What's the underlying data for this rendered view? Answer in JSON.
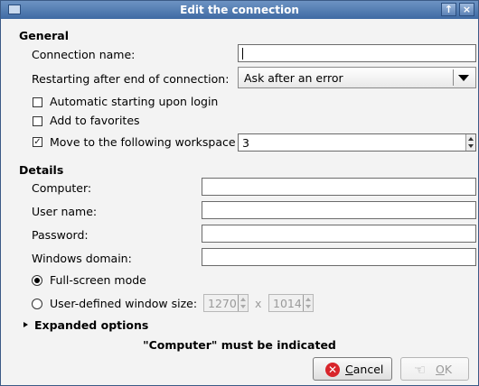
{
  "window": {
    "title": "Edit the connection",
    "controls": {
      "maximize": "↑",
      "close": "×"
    }
  },
  "general": {
    "heading": "General",
    "connection_name_label": "Connection name:",
    "connection_name_value": "",
    "restart_label": "Restarting after end of connection:",
    "restart_value": "Ask after an error",
    "auto_start_label": "Automatic starting upon login",
    "auto_start_checked": false,
    "favorites_label": "Add to favorites",
    "favorites_checked": false,
    "workspace_label": "Move to the following workspace",
    "workspace_checked": true,
    "workspace_value": "3"
  },
  "details": {
    "heading": "Details",
    "computer_label": "Computer:",
    "computer_value": "",
    "username_label": "User name:",
    "username_value": "",
    "password_label": "Password:",
    "password_value": "",
    "domain_label": "Windows domain:",
    "domain_value": "",
    "fullscreen_label": "Full-screen mode",
    "fullscreen_selected": true,
    "custom_size_label": "User-defined window size:",
    "custom_size_selected": false,
    "width_value": "1270",
    "size_separator": "x",
    "height_value": "1014"
  },
  "expanded": {
    "label": "Expanded options"
  },
  "status": {
    "message": "\"Computer\" must be indicated"
  },
  "buttons": {
    "cancel_mnemonic": "C",
    "cancel_rest": "ancel",
    "ok_mnemonic": "O",
    "ok_rest": "K"
  },
  "icons": {
    "cancel": "cancel-icon",
    "ok": "ok-icon",
    "combo_arrow": "chevron-down-icon"
  },
  "colors": {
    "titlebar": "#4f79b0",
    "cancel_icon": "#d8252b"
  }
}
